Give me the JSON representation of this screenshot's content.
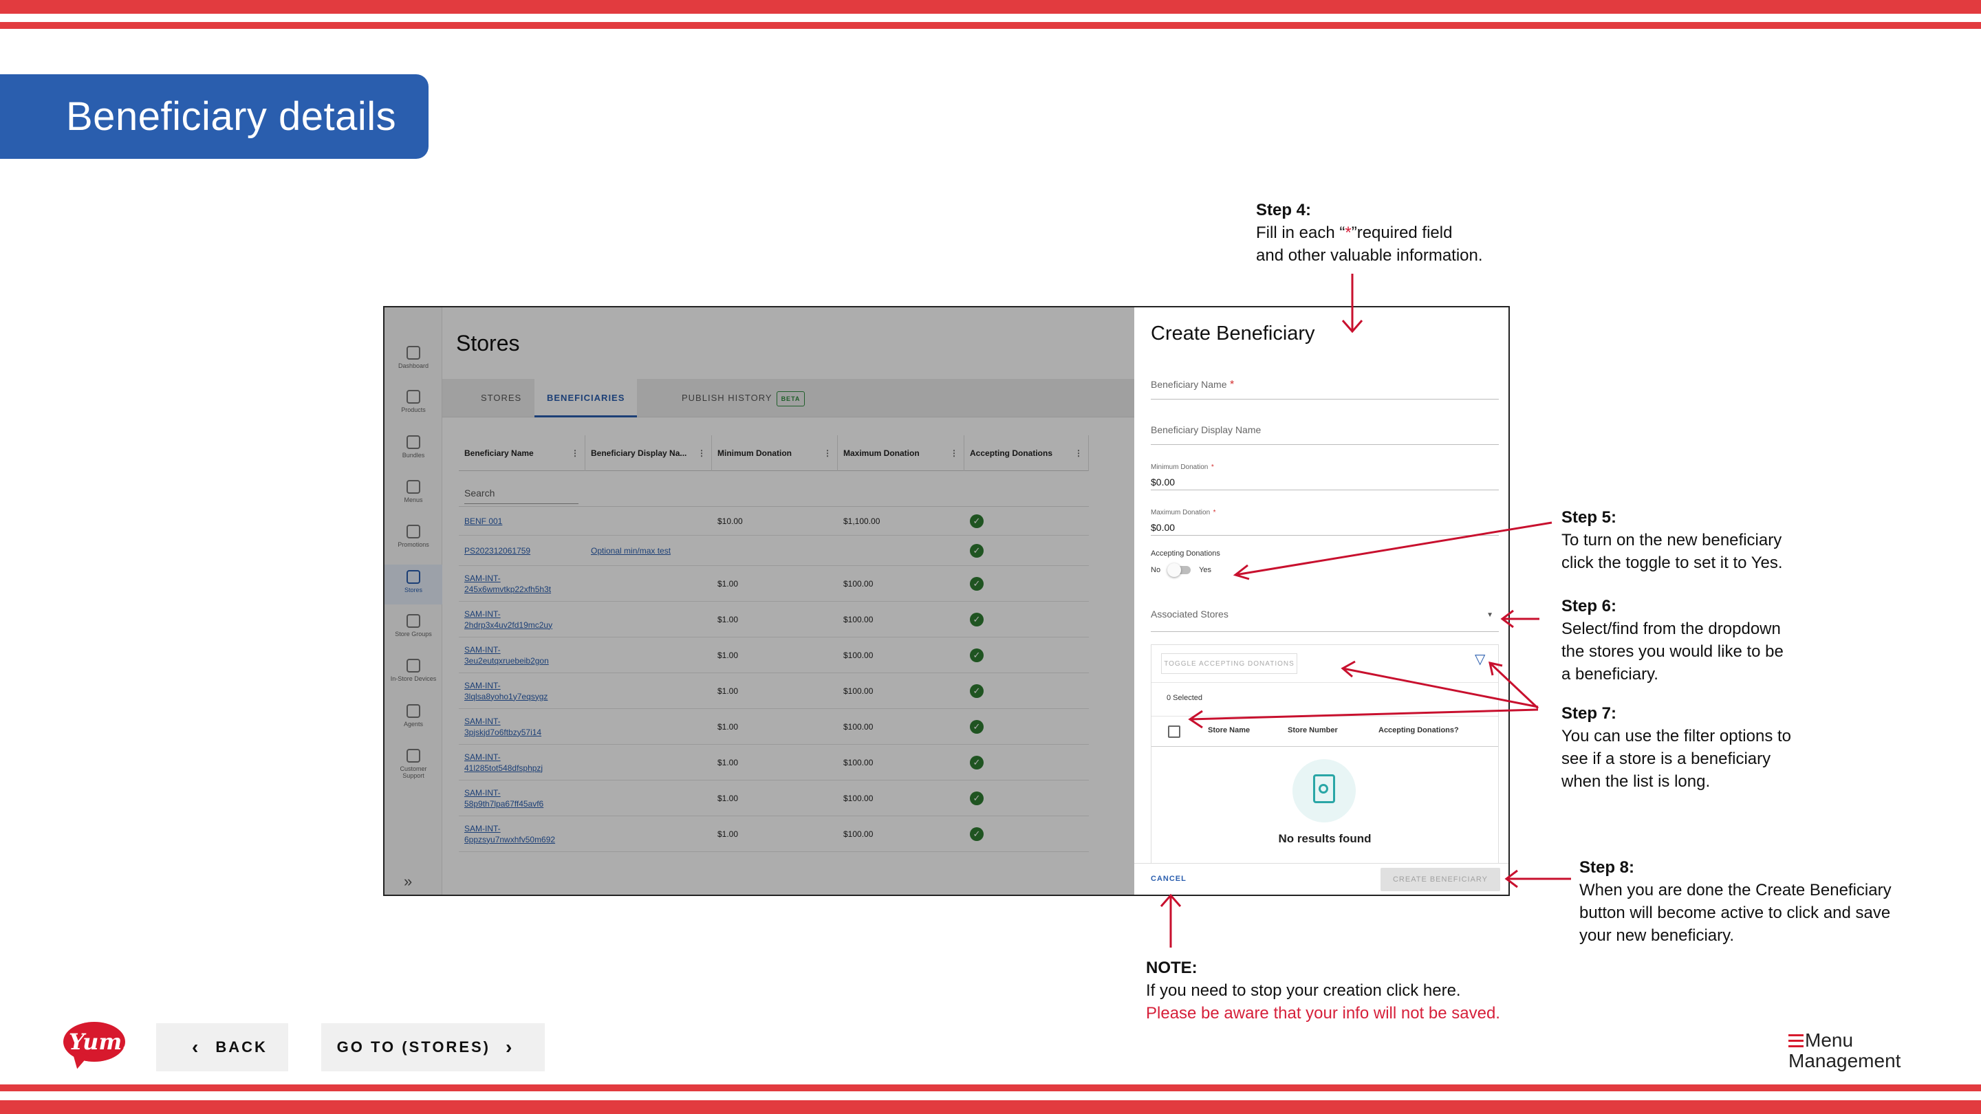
{
  "slide": {
    "title": "Beneficiary details",
    "colors": {
      "accent_red": "#e23b3f",
      "banner_blue": "#2a5eae",
      "note_red": "#d6203a"
    }
  },
  "callouts": {
    "step4": {
      "label": "Step 4:",
      "line1_pre": "Fill in each “",
      "line1_star": "*",
      "line1_post": "”required field",
      "line2": "and other valuable information."
    },
    "step5": {
      "label": "Step 5:",
      "line1": "To turn on the new beneficiary",
      "line2": "click the toggle to set it to Yes."
    },
    "step6": {
      "label": "Step 6:",
      "line1": "Select/find from the dropdown",
      "line2": "the stores you would like to be",
      "line3": "a beneficiary."
    },
    "step7": {
      "label": "Step 7:",
      "line1": "You can use the filter options to",
      "line2": "see if a store is a beneficiary",
      "line3": "when the list is long."
    },
    "step8": {
      "label": "Step 8:",
      "line1": "When you are done the Create Beneficiary",
      "line2": "button will become active to click and save",
      "line3": "your new beneficiary."
    },
    "note": {
      "label": "NOTE:",
      "line1": "If you need to stop your creation click here.",
      "line2": "Please be aware that your info will not be saved."
    }
  },
  "app": {
    "sidebar": {
      "items": [
        {
          "label": "Dashboard",
          "icon": "home-icon"
        },
        {
          "label": "Products",
          "icon": "box-icon"
        },
        {
          "label": "Bundles",
          "icon": "cube-icon"
        },
        {
          "label": "Menus",
          "icon": "document-icon"
        },
        {
          "label": "Promotions",
          "icon": "tag-icon"
        },
        {
          "label": "Stores",
          "icon": "store-icon",
          "active": true
        },
        {
          "label": "Store Groups",
          "icon": "grid-icon"
        },
        {
          "label": "In-Store Devices",
          "icon": "monitor-icon"
        },
        {
          "label": "Agents",
          "icon": "people-icon"
        },
        {
          "label": "Customer Support",
          "icon": "support-icon"
        }
      ],
      "expand_icon": "double-chevron-right-icon"
    },
    "page_title": "Stores",
    "tabs": [
      {
        "label": "STORES"
      },
      {
        "label": "BENEFICIARIES",
        "active": true
      },
      {
        "label": "PUBLISH HISTORY",
        "badge": "BETA"
      }
    ],
    "grid": {
      "columns": [
        "Beneficiary Name",
        "Beneficiary Display Na...",
        "Minimum Donation",
        "Maximum Donation",
        "Accepting Donations"
      ],
      "search_placeholder": "Search",
      "rows": [
        {
          "name": "BENF 001",
          "display": "",
          "min": "$10.00",
          "max": "$1,100.00",
          "accepting": true
        },
        {
          "name": "PS202312061759",
          "display": "Optional min/max test",
          "min": "",
          "max": "",
          "accepting": true
        },
        {
          "name": "SAM-INT-245x6wmvtkp22xfh5h3t",
          "name_l1": "SAM-INT-",
          "name_l2": "245x6wmvtkp22xfh5h3t",
          "display": "",
          "min": "$1.00",
          "max": "$100.00",
          "accepting": true
        },
        {
          "name_l1": "SAM-INT-",
          "name_l2": "2hdrp3x4uv2fd19mc2uy",
          "display": "",
          "min": "$1.00",
          "max": "$100.00",
          "accepting": true
        },
        {
          "name_l1": "SAM-INT-",
          "name_l2": "3eu2eutqxruebeib2gon",
          "display": "",
          "min": "$1.00",
          "max": "$100.00",
          "accepting": true
        },
        {
          "name_l1": "SAM-INT-",
          "name_l2": "3lqlsa8yoho1y7eqsygz",
          "display": "",
          "min": "$1.00",
          "max": "$100.00",
          "accepting": true
        },
        {
          "name_l1": "SAM-INT-",
          "name_l2": "3pjskjd7o6ftbzy57i14",
          "display": "",
          "min": "$1.00",
          "max": "$100.00",
          "accepting": true
        },
        {
          "name_l1": "SAM-INT-",
          "name_l2": "41l285tot548dfsphpzj",
          "display": "",
          "min": "$1.00",
          "max": "$100.00",
          "accepting": true
        },
        {
          "name_l1": "SAM-INT-",
          "name_l2": "58p9th7lpa67ff45avf6",
          "display": "",
          "min": "$1.00",
          "max": "$100.00",
          "accepting": true
        },
        {
          "name_l1": "SAM-INT-",
          "name_l2": "6ppzsyu7nwxhfv50m692",
          "display": "",
          "min": "$1.00",
          "max": "$100.00",
          "accepting": true
        }
      ]
    },
    "drawer": {
      "title": "Create Beneficiary",
      "fields": {
        "name_label": "Beneficiary Name",
        "display_label": "Beneficiary Display Name",
        "min_label": "Minimum Donation",
        "min_value": "$0.00",
        "max_label": "Maximum Donation",
        "max_value": "$0.00",
        "required_mark": "*"
      },
      "accepting_label": "Accepting Donations",
      "toggle_no": "No",
      "toggle_yes": "Yes",
      "associated_stores_label": "Associated Stores",
      "toggle_accepting_button": "TOGGLE ACCEPTING DONATIONS",
      "selected_count": "0 Selected",
      "store_table_columns": [
        "Store Name",
        "Store Number",
        "Accepting Donations?"
      ],
      "empty_text": "No results found",
      "cancel_label": "CANCEL",
      "create_label": "CREATE BENEFICIARY"
    }
  },
  "nav": {
    "back_label": "BACK",
    "goto_label": "GO TO (STORES)"
  },
  "logos": {
    "yum": "Yum!",
    "mm_line1": "Menu",
    "mm_line2": "Management"
  }
}
